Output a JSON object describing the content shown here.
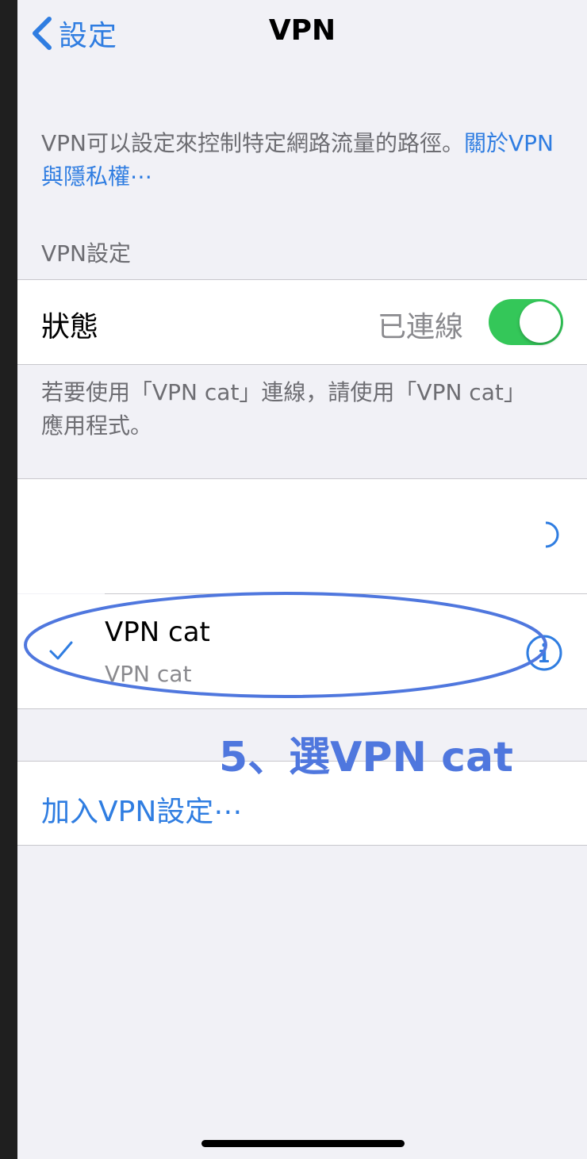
{
  "nav": {
    "back_label": "設定",
    "title": "VPN"
  },
  "intro": {
    "text": "VPN可以設定來控制特定網路流量的路徑。",
    "link_text": "關於VPN與隱私權⋯"
  },
  "section": {
    "header": "VPN設定"
  },
  "status_row": {
    "label": "狀態",
    "value": "已連線",
    "toggle_on": true
  },
  "footer_note": "若要使用「VPN cat」連線，請使用「VPN cat」應用程式。",
  "vpn_config": {
    "name": "VPN cat",
    "subtitle": "VPN cat",
    "selected": true
  },
  "add_vpn_label": "加入VPN設定⋯",
  "annotation": {
    "text": "5、選VPN cat",
    "color": "#4f77de"
  },
  "colors": {
    "accent": "#2f7de1",
    "toggle_on": "#34c759",
    "page_background": "#f1f1f6"
  },
  "icons": {
    "back": "chevron-left-icon",
    "checkmark": "checkmark-icon",
    "info": "info-circle-icon"
  }
}
